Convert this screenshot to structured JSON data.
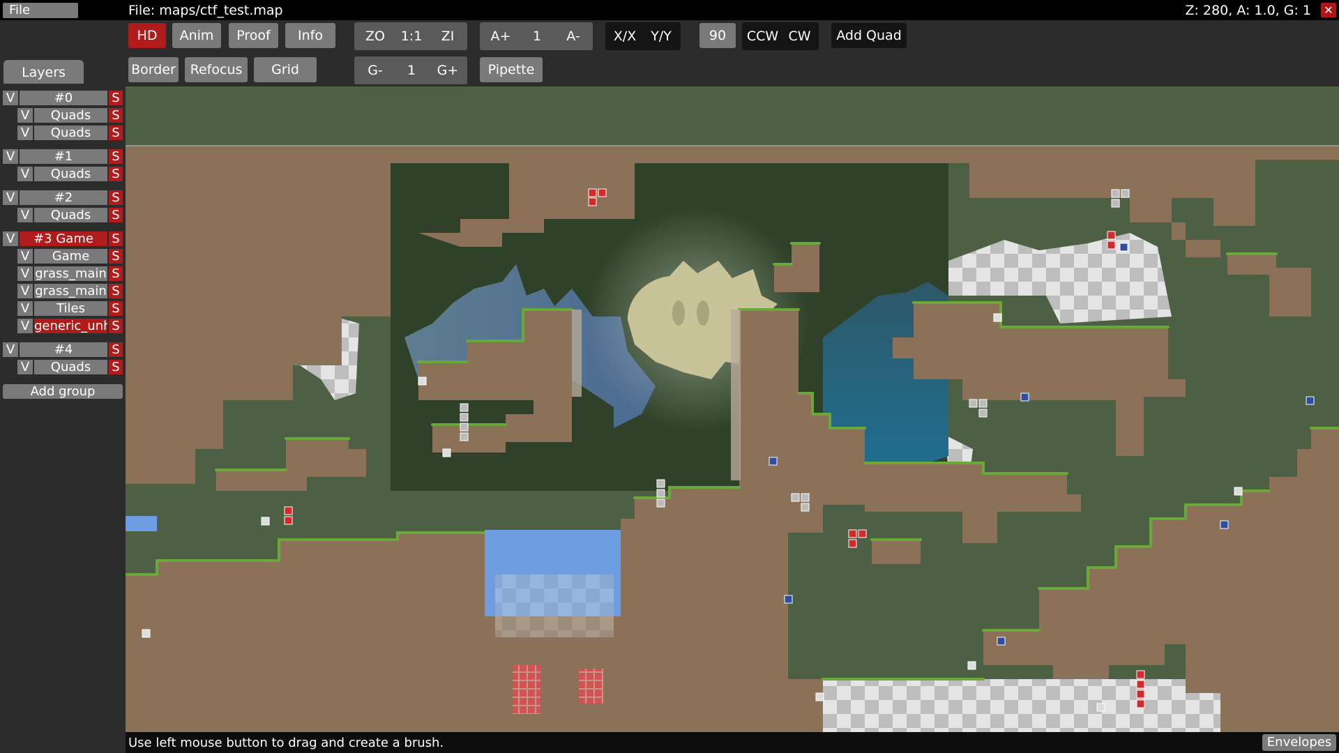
{
  "menu": {
    "file": "File"
  },
  "title": "File: maps/ctf_test.map",
  "status": "Z: 280, A: 1.0, G: 1",
  "close": "✕",
  "toolbar": {
    "row1": {
      "hd": "HD",
      "anim": "Anim",
      "proof": "Proof",
      "info": "Info",
      "zo": "ZO",
      "z11": "1:1",
      "zi": "ZI",
      "a_plus": "A+",
      "a_val": "1",
      "a_minus": "A-",
      "flip_x": "X/X",
      "flip_y": "Y/Y",
      "rot": "90",
      "ccw": "CCW",
      "cw": "CW",
      "add_quad": "Add Quad"
    },
    "row2": {
      "border": "Border",
      "refocus": "Refocus",
      "grid": "Grid",
      "g_minus": "G-",
      "g_val": "1",
      "g_plus": "G+",
      "pipette": "Pipette"
    }
  },
  "layers": {
    "tab": "Layers",
    "rows": [
      {
        "v": "V",
        "name": "#0",
        "s": "S"
      },
      {
        "v": "V",
        "name": "Quads",
        "s": "S"
      },
      {
        "v": "V",
        "name": "Quads",
        "s": "S"
      },
      {
        "v": "V",
        "name": "#1",
        "s": "S"
      },
      {
        "v": "V",
        "name": "Quads",
        "s": "S"
      },
      {
        "v": "V",
        "name": "#2",
        "s": "S"
      },
      {
        "v": "V",
        "name": "Quads",
        "s": "S"
      },
      {
        "v": "V",
        "name": "#3 Game",
        "s": "S"
      },
      {
        "v": "V",
        "name": "Game",
        "s": "S"
      },
      {
        "v": "V",
        "name": "grass_main",
        "s": "S"
      },
      {
        "v": "V",
        "name": "grass_main",
        "s": "S"
      },
      {
        "v": "V",
        "name": "Tiles",
        "s": "S"
      },
      {
        "v": "V",
        "name": "generic_unh",
        "s": "S"
      },
      {
        "v": "V",
        "name": "#4",
        "s": "S"
      },
      {
        "v": "V",
        "name": "Quads",
        "s": "S"
      }
    ],
    "add_group": "Add group"
  },
  "statusbar": {
    "message": "Use left mouse button to drag and create a brush.",
    "envelopes": "Envelopes"
  },
  "colors": {
    "sky": "#4d6044",
    "cave": "#2f4229",
    "dirt": "#8a7158",
    "grass": "#6aa83c",
    "water": "#6e9ce0",
    "moon": "#cfcaa0",
    "accent": "#b01c1c"
  }
}
